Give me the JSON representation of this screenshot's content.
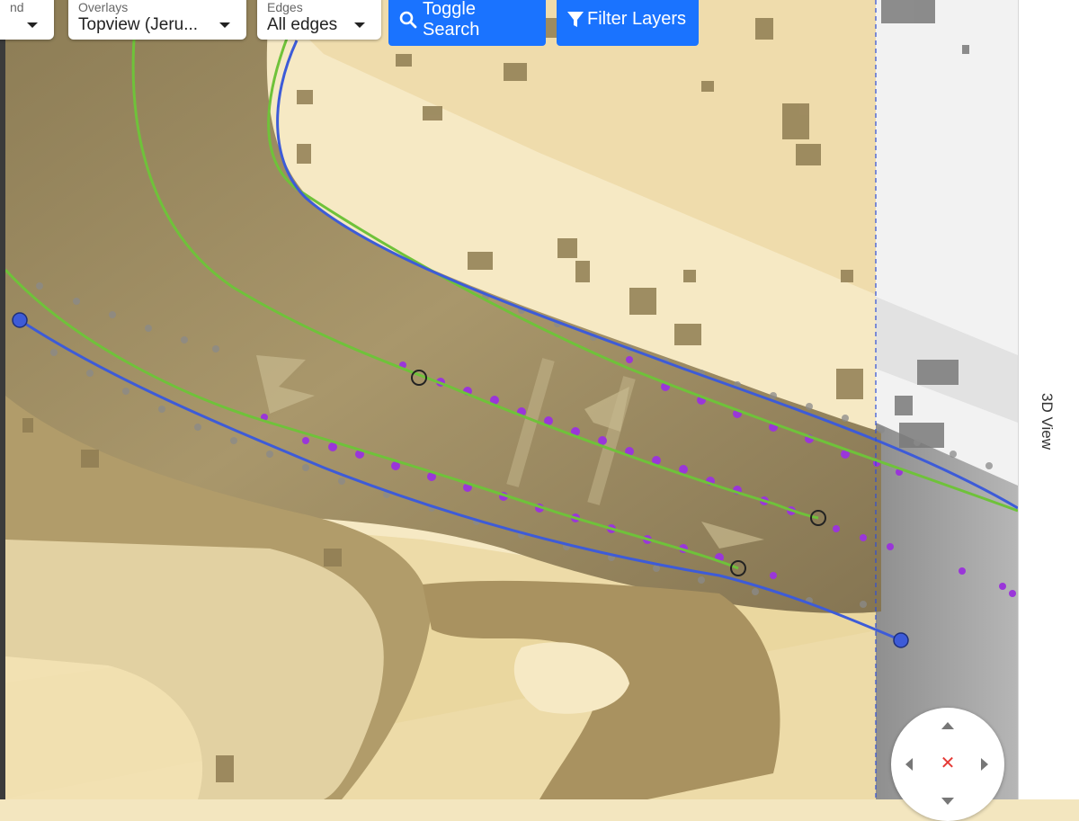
{
  "toolbar": {
    "dropdowns": [
      {
        "label": "nd",
        "value": ""
      },
      {
        "label": "Overlays",
        "value": "Topview (Jeru..."
      },
      {
        "label": "Edges",
        "value": "All edges"
      }
    ],
    "toggle_search_label": "Toggle Search",
    "filter_layers_label": "Filter Layers"
  },
  "side_panel": {
    "label": "3D View"
  },
  "nav_control": {
    "reset_glyph": "✕"
  },
  "colors": {
    "lane_blue": "#3d5bd8",
    "lane_green": "#6fc23a",
    "points_purple": "#9a36d9",
    "points_gray": "#8a8a8a",
    "button_blue": "#1a73ff",
    "sand_light": "#f6e9c4",
    "sand_dark": "#9d8a5f"
  }
}
